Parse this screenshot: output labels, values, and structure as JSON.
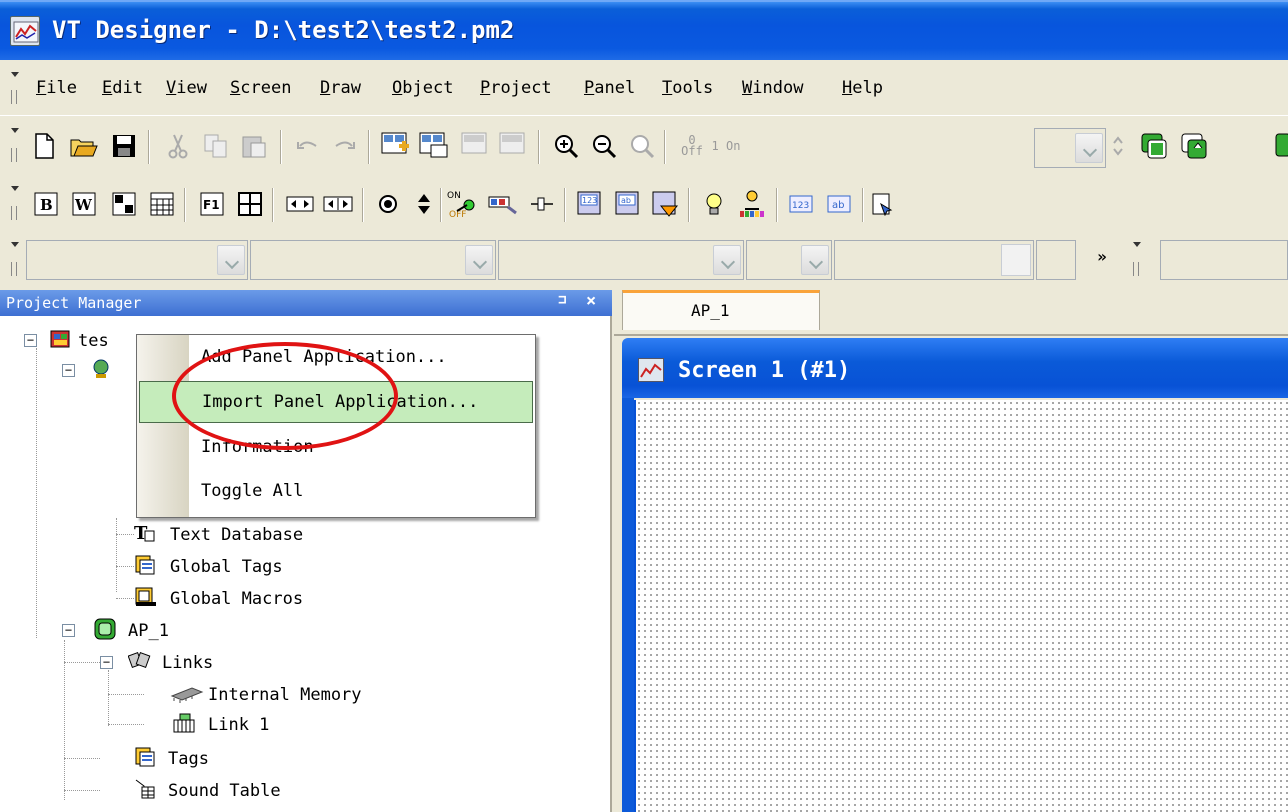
{
  "window": {
    "title": "VT Designer - D:\\test2\\test2.pm2"
  },
  "menubar": {
    "items": [
      "File",
      "Edit",
      "View",
      "Screen",
      "Draw",
      "Object",
      "Project",
      "Panel",
      "Tools",
      "Window",
      "Help"
    ]
  },
  "toolbar1": {
    "buttons": [
      "new-icon",
      "open-icon",
      "save-icon",
      "cut-icon",
      "copy-icon",
      "paste-icon",
      "undo-icon",
      "redo-icon",
      "add-screen-icon",
      "screen-properties-icon",
      "screen-disabled-icon",
      "screen-disabled2-icon",
      "zoom-in-icon",
      "zoom-out-icon",
      "zoom-disabled-icon",
      "off-state-icon",
      "on-state-icon"
    ],
    "state_off_label": "0 Off",
    "state_on_label": "1 On"
  },
  "toolbar2": {
    "buttons": [
      "bitmap-b-icon",
      "word-w-icon",
      "grid-icon",
      "calendar-icon",
      "function-key-icon",
      "table-icon",
      "step-icon",
      "step-wide-icon",
      "radio-icon",
      "up-down-icon",
      "on-off-switch-icon",
      "message-icon",
      "slider-icon",
      "numeric-input-icon",
      "ascii-input-icon",
      "message-display-icon",
      "lamp-icon",
      "user-icon",
      "numeric-display-icon",
      "ascii-display-icon",
      "text-icon"
    ]
  },
  "project_manager": {
    "title": "Project Manager",
    "pin_label": "⊐",
    "close_label": "×",
    "root_label": "tes",
    "items": {
      "text_database": "Text Database",
      "global_tags": "Global Tags",
      "global_macros": "Global Macros",
      "ap1": "AP_1",
      "links": "Links",
      "internal_memory": "Internal Memory",
      "link1": "Link 1",
      "tags": "Tags",
      "sound_table": "Sound Table"
    }
  },
  "context_menu": {
    "items": [
      "Add Panel Application...",
      "Import Panel Application...",
      "Information",
      "Toggle All"
    ],
    "highlighted_index": 1
  },
  "editor": {
    "tab_label": "AP_1",
    "screen_title": "Screen 1 (#1)"
  },
  "colors": {
    "title_bar": "#0855dd",
    "highlight": "#c5ecbb",
    "annotation": "#e01313",
    "tab_accent": "#f9a33a"
  }
}
